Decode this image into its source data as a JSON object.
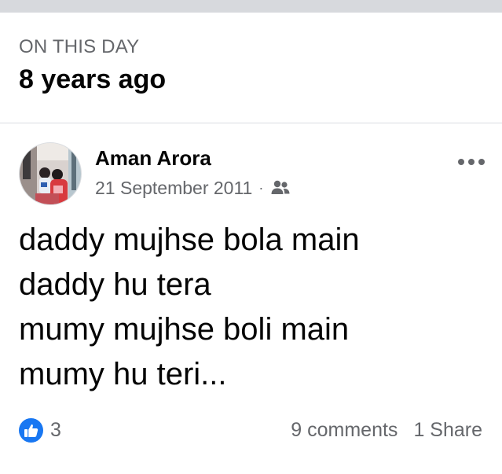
{
  "memory": {
    "label": "ON THIS DAY",
    "title": "8 years ago"
  },
  "post": {
    "author": "Aman Arora",
    "date": "21 September 2011",
    "separator": "·",
    "audience_icon": "friends-icon",
    "more_icon": "more-options-icon",
    "text_lines": [
      "daddy mujhse bola main",
      "daddy hu tera",
      "mumy mujhse boli main",
      "mumy hu teri..."
    ],
    "reaction_icon": "like-icon",
    "reaction_count": "3",
    "comments": "9 comments",
    "shares": "1 Share"
  },
  "colors": {
    "like_blue": "#1877f2",
    "secondary_text": "#65676b",
    "primary_text": "#050505",
    "divider": "#dadde1"
  }
}
